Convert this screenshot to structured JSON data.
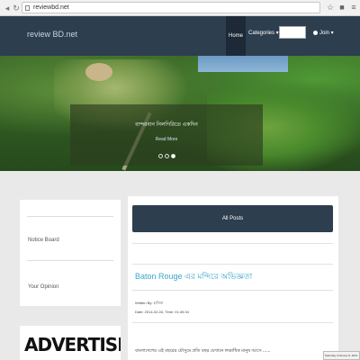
{
  "browser": {
    "url": "reviewbd.net"
  },
  "navbar": {
    "brand": "review BD.net",
    "home_label": "Home",
    "category_label": "Categories ▾",
    "search_placeholder": "",
    "join_label": "Join ▾"
  },
  "hero": {
    "caption_title": "বান্দরবান নিলগিরিতে একদিন",
    "read_more": "Read More"
  },
  "sidebar": {
    "items": [
      {
        "label": "Notice Board"
      },
      {
        "label": "Your Opinion"
      }
    ],
    "advert": "ADVERTISE"
  },
  "main": {
    "header": "All Posts",
    "post": {
      "title": "Baton Rouge এর মন্দিরে অভিজ্ঞতা",
      "written_by": "Written By: হাসিনা",
      "date": "Date: 2014-02-04, Time: 01:40:34",
      "excerpt": "বাংলাদেশের এই বছরের মৌসুমে প্রতি বছর যেখানে লক্ষাধিক মানুষ আসে ......"
    }
  },
  "status": {
    "clock": "Saturday, February 8, 2014"
  }
}
